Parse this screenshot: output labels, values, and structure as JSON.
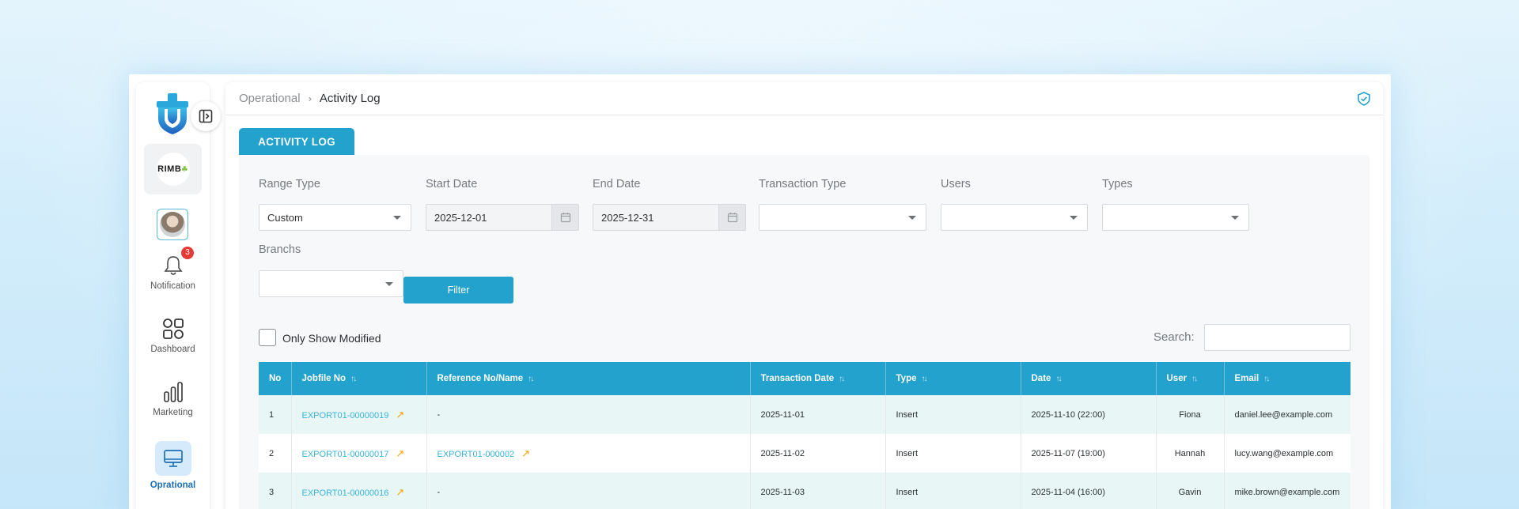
{
  "breadcrumb": {
    "parent": "Operational",
    "current": "Activity Log"
  },
  "sidebar": {
    "brand_text": "RIMB",
    "notification_count": "3",
    "items": [
      {
        "label": "Notification",
        "icon": "bell-icon"
      },
      {
        "label": "Dashboard",
        "icon": "grid-icon"
      },
      {
        "label": "Marketing",
        "icon": "bar-chart-icon"
      },
      {
        "label": "Oprational",
        "icon": "monitor-icon",
        "active": true
      }
    ]
  },
  "tab": {
    "label": "ACTIVITY LOG"
  },
  "filters": {
    "range_type": {
      "label": "Range Type",
      "value": "Custom"
    },
    "start_date": {
      "label": "Start Date",
      "value": "2025-12-01"
    },
    "end_date": {
      "label": "End Date",
      "value": "2025-12-31"
    },
    "transaction_type": {
      "label": "Transaction Type",
      "value": ""
    },
    "users": {
      "label": "Users",
      "value": ""
    },
    "types": {
      "label": "Types",
      "value": ""
    },
    "branches": {
      "label": "Branchs",
      "value": ""
    },
    "filter_button": "Filter"
  },
  "only_modified_label": "Only Show Modified",
  "search_label": "Search:",
  "table": {
    "headers": [
      "No",
      "Jobfile No",
      "Reference No/Name",
      "Transaction Date",
      "Type",
      "Date",
      "User",
      "Email"
    ],
    "rows": [
      {
        "no": "1",
        "jobfile": "EXPORT01-00000019",
        "reference": "-",
        "tx_date": "2025-11-01",
        "type": "Insert",
        "date": "2025-11-10 (22:00)",
        "user": "Fiona",
        "email": "daniel.lee@example.com"
      },
      {
        "no": "2",
        "jobfile": "EXPORT01-00000017",
        "reference": "EXPORT01-000002",
        "tx_date": "2025-11-02",
        "type": "Insert",
        "date": "2025-11-07 (19:00)",
        "user": "Hannah",
        "email": "lucy.wang@example.com"
      },
      {
        "no": "3",
        "jobfile": "EXPORT01-00000016",
        "reference": "-",
        "tx_date": "2025-11-03",
        "type": "Insert",
        "date": "2025-11-04 (16:00)",
        "user": "Gavin",
        "email": "mike.brown@example.com"
      }
    ]
  },
  "colors": {
    "accent": "#22a2cc",
    "link": "#39b4d8",
    "badge": "#e53935",
    "row_alt": "#e8f6f5"
  }
}
